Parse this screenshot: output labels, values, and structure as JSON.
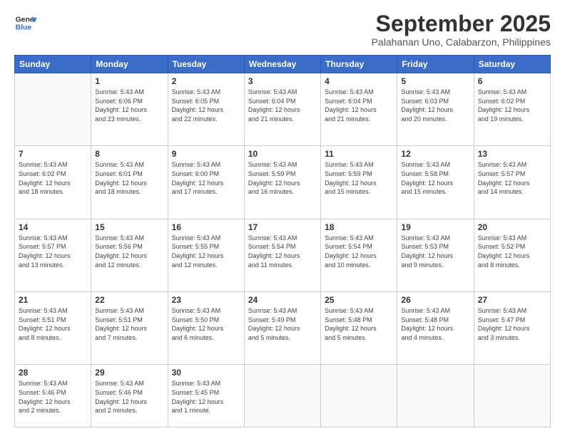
{
  "header": {
    "logo_line1": "General",
    "logo_line2": "Blue",
    "month": "September 2025",
    "location": "Palahanan Uno, Calabarzon, Philippines"
  },
  "weekdays": [
    "Sunday",
    "Monday",
    "Tuesday",
    "Wednesday",
    "Thursday",
    "Friday",
    "Saturday"
  ],
  "weeks": [
    [
      {
        "day": "",
        "info": ""
      },
      {
        "day": "1",
        "info": "Sunrise: 5:43 AM\nSunset: 6:06 PM\nDaylight: 12 hours\nand 23 minutes."
      },
      {
        "day": "2",
        "info": "Sunrise: 5:43 AM\nSunset: 6:05 PM\nDaylight: 12 hours\nand 22 minutes."
      },
      {
        "day": "3",
        "info": "Sunrise: 5:43 AM\nSunset: 6:04 PM\nDaylight: 12 hours\nand 21 minutes."
      },
      {
        "day": "4",
        "info": "Sunrise: 5:43 AM\nSunset: 6:04 PM\nDaylight: 12 hours\nand 21 minutes."
      },
      {
        "day": "5",
        "info": "Sunrise: 5:43 AM\nSunset: 6:03 PM\nDaylight: 12 hours\nand 20 minutes."
      },
      {
        "day": "6",
        "info": "Sunrise: 5:43 AM\nSunset: 6:02 PM\nDaylight: 12 hours\nand 19 minutes."
      }
    ],
    [
      {
        "day": "7",
        "info": "Sunrise: 5:43 AM\nSunset: 6:02 PM\nDaylight: 12 hours\nand 18 minutes."
      },
      {
        "day": "8",
        "info": "Sunrise: 5:43 AM\nSunset: 6:01 PM\nDaylight: 12 hours\nand 18 minutes."
      },
      {
        "day": "9",
        "info": "Sunrise: 5:43 AM\nSunset: 6:00 PM\nDaylight: 12 hours\nand 17 minutes."
      },
      {
        "day": "10",
        "info": "Sunrise: 5:43 AM\nSunset: 5:59 PM\nDaylight: 12 hours\nand 16 minutes."
      },
      {
        "day": "11",
        "info": "Sunrise: 5:43 AM\nSunset: 5:59 PM\nDaylight: 12 hours\nand 15 minutes."
      },
      {
        "day": "12",
        "info": "Sunrise: 5:43 AM\nSunset: 5:58 PM\nDaylight: 12 hours\nand 15 minutes."
      },
      {
        "day": "13",
        "info": "Sunrise: 5:43 AM\nSunset: 5:57 PM\nDaylight: 12 hours\nand 14 minutes."
      }
    ],
    [
      {
        "day": "14",
        "info": "Sunrise: 5:43 AM\nSunset: 5:57 PM\nDaylight: 12 hours\nand 13 minutes."
      },
      {
        "day": "15",
        "info": "Sunrise: 5:43 AM\nSunset: 5:56 PM\nDaylight: 12 hours\nand 12 minutes."
      },
      {
        "day": "16",
        "info": "Sunrise: 5:43 AM\nSunset: 5:55 PM\nDaylight: 12 hours\nand 12 minutes."
      },
      {
        "day": "17",
        "info": "Sunrise: 5:43 AM\nSunset: 5:54 PM\nDaylight: 12 hours\nand 11 minutes."
      },
      {
        "day": "18",
        "info": "Sunrise: 5:43 AM\nSunset: 5:54 PM\nDaylight: 12 hours\nand 10 minutes."
      },
      {
        "day": "19",
        "info": "Sunrise: 5:43 AM\nSunset: 5:53 PM\nDaylight: 12 hours\nand 9 minutes."
      },
      {
        "day": "20",
        "info": "Sunrise: 5:43 AM\nSunset: 5:52 PM\nDaylight: 12 hours\nand 8 minutes."
      }
    ],
    [
      {
        "day": "21",
        "info": "Sunrise: 5:43 AM\nSunset: 5:51 PM\nDaylight: 12 hours\nand 8 minutes."
      },
      {
        "day": "22",
        "info": "Sunrise: 5:43 AM\nSunset: 5:51 PM\nDaylight: 12 hours\nand 7 minutes."
      },
      {
        "day": "23",
        "info": "Sunrise: 5:43 AM\nSunset: 5:50 PM\nDaylight: 12 hours\nand 6 minutes."
      },
      {
        "day": "24",
        "info": "Sunrise: 5:43 AM\nSunset: 5:49 PM\nDaylight: 12 hours\nand 5 minutes."
      },
      {
        "day": "25",
        "info": "Sunrise: 5:43 AM\nSunset: 5:48 PM\nDaylight: 12 hours\nand 5 minutes."
      },
      {
        "day": "26",
        "info": "Sunrise: 5:43 AM\nSunset: 5:48 PM\nDaylight: 12 hours\nand 4 minutes."
      },
      {
        "day": "27",
        "info": "Sunrise: 5:43 AM\nSunset: 5:47 PM\nDaylight: 12 hours\nand 3 minutes."
      }
    ],
    [
      {
        "day": "28",
        "info": "Sunrise: 5:43 AM\nSunset: 5:46 PM\nDaylight: 12 hours\nand 2 minutes."
      },
      {
        "day": "29",
        "info": "Sunrise: 5:43 AM\nSunset: 5:46 PM\nDaylight: 12 hours\nand 2 minutes."
      },
      {
        "day": "30",
        "info": "Sunrise: 5:43 AM\nSunset: 5:45 PM\nDaylight: 12 hours\nand 1 minute."
      },
      {
        "day": "",
        "info": ""
      },
      {
        "day": "",
        "info": ""
      },
      {
        "day": "",
        "info": ""
      },
      {
        "day": "",
        "info": ""
      }
    ]
  ]
}
